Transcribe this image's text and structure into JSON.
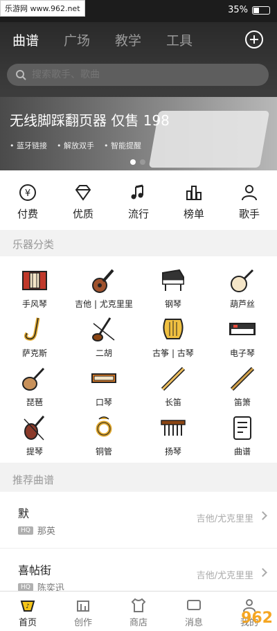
{
  "status": {
    "watermark": "乐游网 www.962.net",
    "battery": "35%"
  },
  "header": {
    "tabs": [
      "曲谱",
      "广场",
      "教学",
      "工具"
    ],
    "search_placeholder": "搜索歌手、歌曲"
  },
  "banner": {
    "title": "无线脚踩翻页器  仅售 198",
    "features": [
      "• 蓝牙链接",
      "• 解放双手",
      "• 智能提醒"
    ]
  },
  "quicknav": [
    {
      "label": "付费",
      "icon": "yen-icon"
    },
    {
      "label": "优质",
      "icon": "diamond-icon"
    },
    {
      "label": "流行",
      "icon": "music-note-icon"
    },
    {
      "label": "榜单",
      "icon": "bar-chart-icon"
    },
    {
      "label": "歌手",
      "icon": "person-icon"
    }
  ],
  "instruments_title": "乐器分类",
  "instruments": [
    {
      "label": "手风琴",
      "icon": "accordion-icon"
    },
    {
      "label": "吉他 | 尤克里里",
      "icon": "guitar-icon"
    },
    {
      "label": "钢琴",
      "icon": "piano-icon"
    },
    {
      "label": "葫芦丝",
      "icon": "banjo-icon"
    },
    {
      "label": "萨克斯",
      "icon": "saxophone-icon"
    },
    {
      "label": "二胡",
      "icon": "erhu-icon"
    },
    {
      "label": "古筝 | 古琴",
      "icon": "harp-icon"
    },
    {
      "label": "电子琴",
      "icon": "keyboard-icon"
    },
    {
      "label": "琵琶",
      "icon": "pipa-icon"
    },
    {
      "label": "口琴",
      "icon": "harmonica-icon"
    },
    {
      "label": "长笛",
      "icon": "flute-icon"
    },
    {
      "label": "笛箫",
      "icon": "dizi-icon"
    },
    {
      "label": "提琴",
      "icon": "violin-icon"
    },
    {
      "label": "铜管",
      "icon": "brass-icon"
    },
    {
      "label": "扬琴",
      "icon": "dulcimer-icon"
    },
    {
      "label": "曲谱",
      "icon": "score-icon"
    }
  ],
  "recommend_title": "推荐曲谱",
  "songs": [
    {
      "title": "默",
      "badge": "HQ",
      "artist": "那英",
      "category": "吉他/尤克里里"
    },
    {
      "title": "喜帖街",
      "badge": "HQ",
      "artist": "陈奕迅",
      "category": "吉他/尤克里里"
    }
  ],
  "bottomnav": [
    {
      "label": "首页",
      "icon": "home-icon"
    },
    {
      "label": "创作",
      "icon": "create-icon"
    },
    {
      "label": "商店",
      "icon": "shirt-icon"
    },
    {
      "label": "消息",
      "icon": "message-icon"
    },
    {
      "label": "我的",
      "icon": "user-icon"
    }
  ],
  "corner_watermark": "962"
}
